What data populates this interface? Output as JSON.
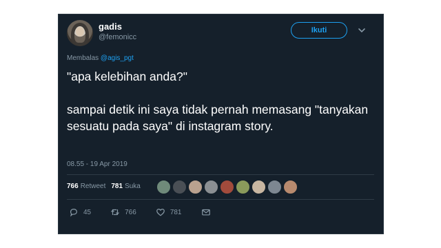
{
  "tweet": {
    "display_name": "gadis",
    "handle": "@femonicc",
    "follow_label": "Ikuti",
    "reply_prefix": "Membalas",
    "reply_mention": "@agis_pgt",
    "line1": "\"apa kelebihan anda?\"",
    "line2": "sampai detik ini saya tidak pernah memasang \"tanyakan sesuatu pada saya\" di instagram story.",
    "timestamp": "08.55 - 19 Apr 2019"
  },
  "stats": {
    "retweet_count": "766",
    "retweet_label": "Retweet",
    "like_count": "781",
    "like_label": "Suka"
  },
  "actions": {
    "reply_count": "45",
    "retweet_count": "766",
    "like_count": "781"
  },
  "colors": {
    "background": "#15202b",
    "accent": "#1da1f2",
    "muted": "#8899a6"
  }
}
